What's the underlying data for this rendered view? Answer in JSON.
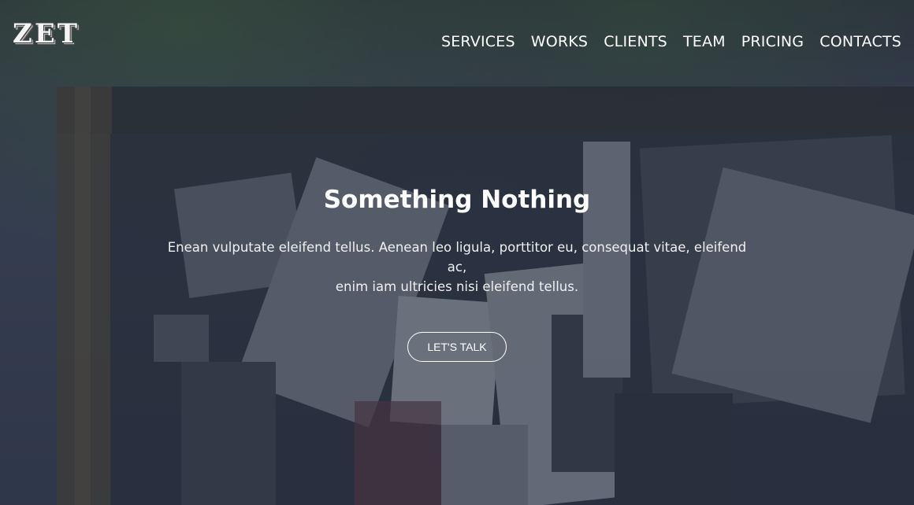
{
  "brand": {
    "logo_text": "ZET"
  },
  "nav": {
    "items": [
      {
        "label": "SERVICES"
      },
      {
        "label": "WORKS"
      },
      {
        "label": "CLIENTS"
      },
      {
        "label": "TEAM"
      },
      {
        "label": "PRICING"
      },
      {
        "label": "CONTACTS"
      }
    ]
  },
  "hero": {
    "title": "Something Nothing",
    "lead_line_1": "Enean vulputate eleifend tellus. Aenean leo ligula, porttitor eu, consequat vitae, eleifend ac,",
    "lead_line_2": "enim iam ultricies nisi eleifend tellus.",
    "cta_label": "LET'S TALK"
  },
  "colors": {
    "overlay": "#283042",
    "text": "#ffffff"
  }
}
